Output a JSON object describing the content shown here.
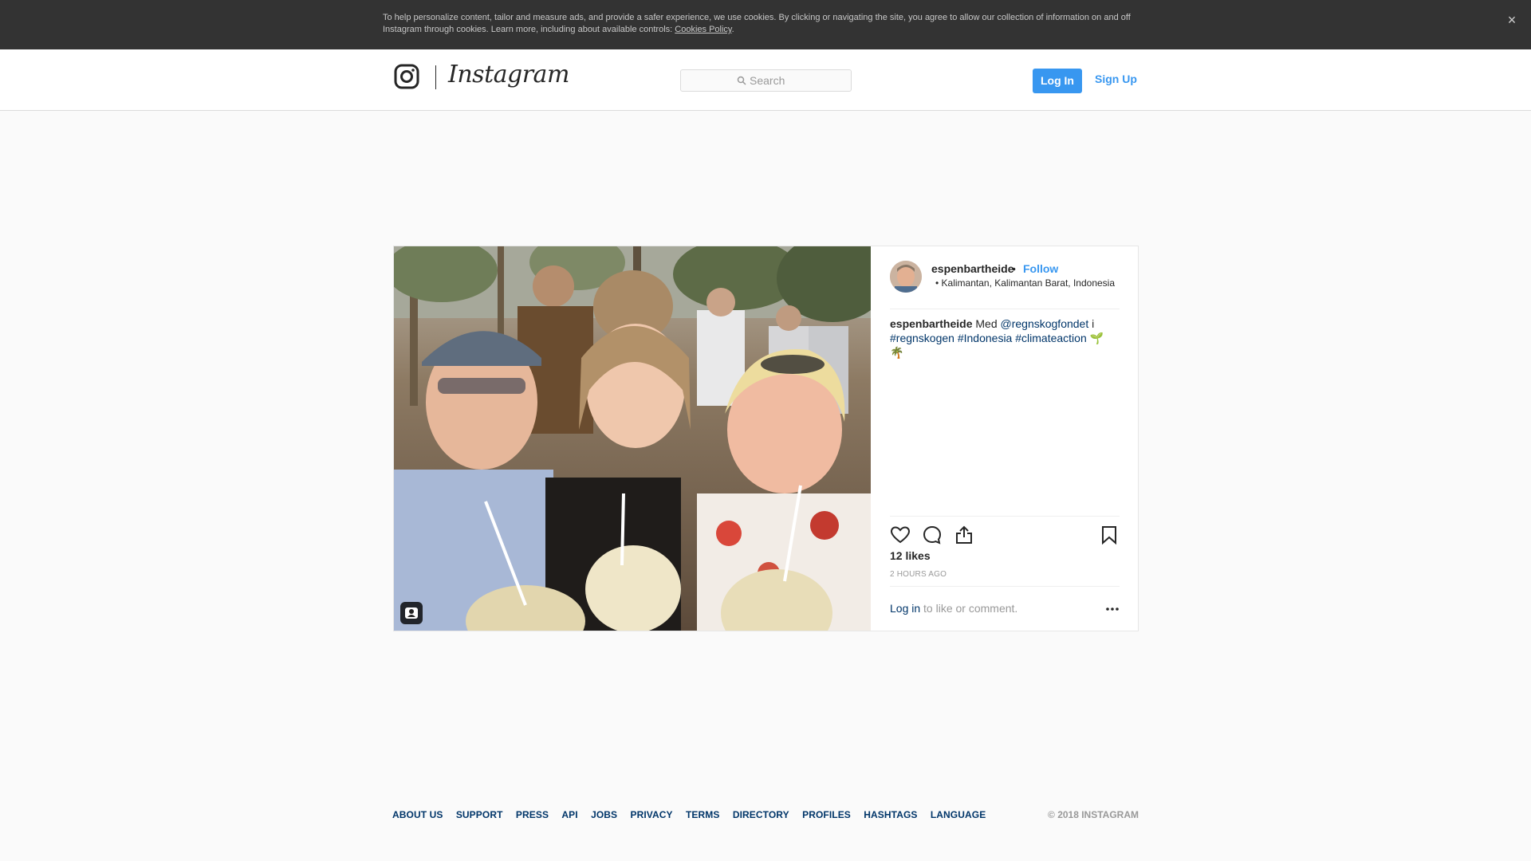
{
  "cookie_banner": {
    "text": "To help personalize content, tailor and measure ads, and provide a safer experience, we use cookies. By clicking or navigating the site, you agree to allow our collection of information on and off Instagram through cookies. Learn more, including about available controls: ",
    "link": "Cookies Policy",
    "end": ".",
    "close_glyph": "×"
  },
  "header": {
    "wordmark": "Instagram",
    "search_placeholder": "Search",
    "login_label": "Log In",
    "signup_label": "Sign Up"
  },
  "post": {
    "username": "espenbartheide",
    "separator": "•",
    "follow_label": "Follow",
    "location": "• Kalimantan, Kalimantan Barat, Indonesia",
    "caption": {
      "username": "espenbartheide",
      "text_1": " Med ",
      "mention": "@regnskogfondet",
      "text_2": " i ",
      "hashtag_1": "#regnskogen",
      "hashtag_2": "#Indonesia",
      "hashtag_3": "#climateaction",
      "trailing": " 🌱 🌴"
    },
    "likes": "12 likes",
    "timestamp": "2 HOURS AGO",
    "login_link": "Log in",
    "login_rest": " to like or comment."
  },
  "footer": {
    "links": [
      "ABOUT US",
      "SUPPORT",
      "PRESS",
      "API",
      "JOBS",
      "PRIVACY",
      "TERMS",
      "DIRECTORY",
      "PROFILES",
      "HASHTAGS",
      "LANGUAGE"
    ],
    "copyright": "© 2018 INSTAGRAM"
  },
  "icons": {
    "logo": "instagram-camera-icon",
    "search": "search-icon",
    "like": "heart-icon",
    "comment": "comment-icon",
    "share": "share-icon",
    "save": "bookmark-icon",
    "more": "more-icon",
    "tag": "user-tag-icon"
  },
  "colors": {
    "accent": "#3897f0",
    "link": "#003569",
    "banner": "#333333"
  }
}
